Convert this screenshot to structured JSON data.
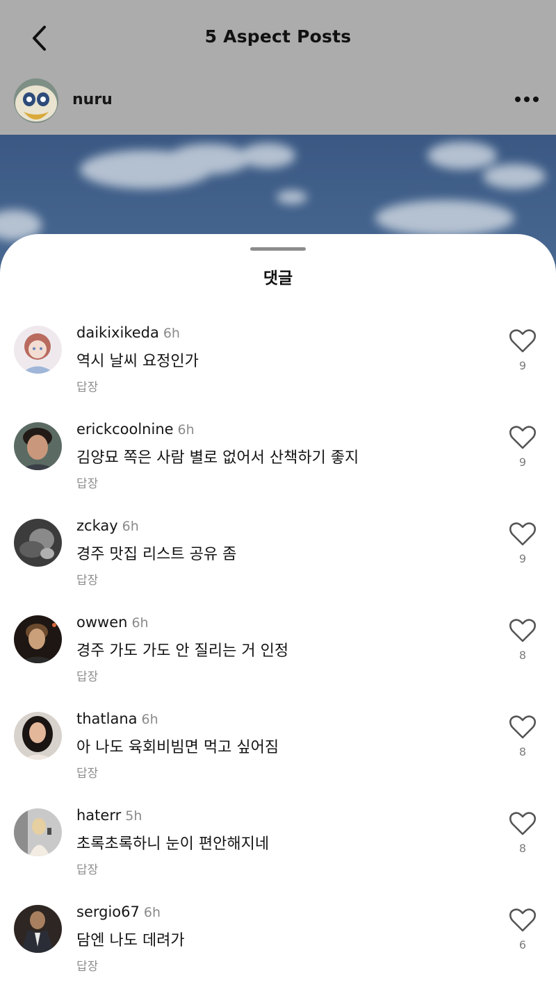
{
  "header": {
    "title": "5 Aspect Posts",
    "back_icon": "chevron-left-icon",
    "more_icon": "more-horizontal-icon"
  },
  "post": {
    "author": "nuru"
  },
  "comments_sheet": {
    "title": "댓글",
    "comments": [
      {
        "username": "daikixikeda",
        "time": "6h",
        "text": "역시 날씨 요정인가",
        "reply_label": "답장",
        "likes": "9"
      },
      {
        "username": "erickcoolnine",
        "time": "6h",
        "text": "김양묘 쪽은 사람 별로 없어서 산책하기 좋지",
        "reply_label": "답장",
        "likes": "9"
      },
      {
        "username": "zckay",
        "time": "6h",
        "text": "경주 맛집 리스트 공유 좀",
        "reply_label": "답장",
        "likes": "9"
      },
      {
        "username": "owwen",
        "time": "6h",
        "text": "경주 가도 가도 안 질리는 거 인정",
        "reply_label": "답장",
        "likes": "8"
      },
      {
        "username": "thatlana",
        "time": "6h",
        "text": "아 나도 육회비빔면 먹고 싶어짐",
        "reply_label": "답장",
        "likes": "8"
      },
      {
        "username": "haterr",
        "time": "5h",
        "text": "초록초록하니 눈이 편안해지네",
        "reply_label": "답장",
        "likes": "8"
      },
      {
        "username": "sergio67",
        "time": "6h",
        "text": "담엔 나도 데려가",
        "reply_label": "답장",
        "likes": "6"
      }
    ]
  },
  "colors": {
    "dim_overlay": "#acacac",
    "sky": "#3f5f87",
    "secondary_text": "#8a8a8a"
  }
}
